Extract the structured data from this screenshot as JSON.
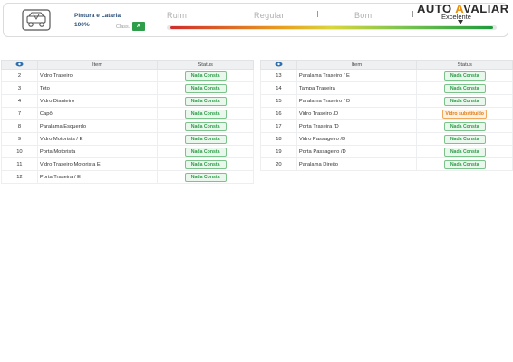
{
  "header": {
    "category_title": "Pintura e Lataria",
    "category_percent": "100%",
    "class_label": "Class.",
    "class_value": "A",
    "scale": [
      "Ruim",
      "Regular",
      "Bom"
    ],
    "brand_part1": "AUTO ",
    "brand_a": "A",
    "brand_part2": "VALIAR",
    "rating": "Excelente",
    "gauge_level_percent": 90
  },
  "table_headers": {
    "num": "",
    "item": "Item",
    "status": "Status"
  },
  "tables": [
    {
      "rows": [
        {
          "num": "2",
          "item": "Vidro Traseiro",
          "status": "Nada Consta",
          "kind": "ok"
        },
        {
          "num": "3",
          "item": "Teto",
          "status": "Nada Consta",
          "kind": "ok"
        },
        {
          "num": "4",
          "item": "Vidro Dianteiro",
          "status": "Nada Consta",
          "kind": "ok"
        },
        {
          "num": "7",
          "item": "Capô",
          "status": "Nada Consta",
          "kind": "ok"
        },
        {
          "num": "8",
          "item": "Paralama Esquerdo",
          "status": "Nada Consta",
          "kind": "ok"
        },
        {
          "num": "9",
          "item": "Vidro Motorista / E",
          "status": "Nada Consta",
          "kind": "ok"
        },
        {
          "num": "10",
          "item": "Porta Motorista",
          "status": "Nada Consta",
          "kind": "ok"
        },
        {
          "num": "11",
          "item": "Vidro Traseiro Motorista E",
          "status": "Nada Consta",
          "kind": "ok"
        },
        {
          "num": "12",
          "item": "Porta Traseira / E",
          "status": "Nada Consta",
          "kind": "ok"
        }
      ]
    },
    {
      "rows": [
        {
          "num": "13",
          "item": "Paralama Traseiro / E",
          "status": "Nada Consta",
          "kind": "ok"
        },
        {
          "num": "14",
          "item": "Tampa Traseira",
          "status": "Nada Consta",
          "kind": "ok"
        },
        {
          "num": "15",
          "item": "Paralama Traseiro / D",
          "status": "Nada Consta",
          "kind": "ok"
        },
        {
          "num": "16",
          "item": "Vidro Traseiro /D",
          "status": "Vidro substituído",
          "kind": "warn"
        },
        {
          "num": "17",
          "item": "Porta Traseira /D",
          "status": "Nada Consta",
          "kind": "ok"
        },
        {
          "num": "18",
          "item": "Vidro Passageiro /D",
          "status": "Nada Consta",
          "kind": "ok"
        },
        {
          "num": "19",
          "item": "Porta Passageiro /D",
          "status": "Nada Consta",
          "kind": "ok"
        },
        {
          "num": "20",
          "item": "Paralama Direito",
          "status": "Nada Consta",
          "kind": "ok"
        }
      ]
    }
  ]
}
